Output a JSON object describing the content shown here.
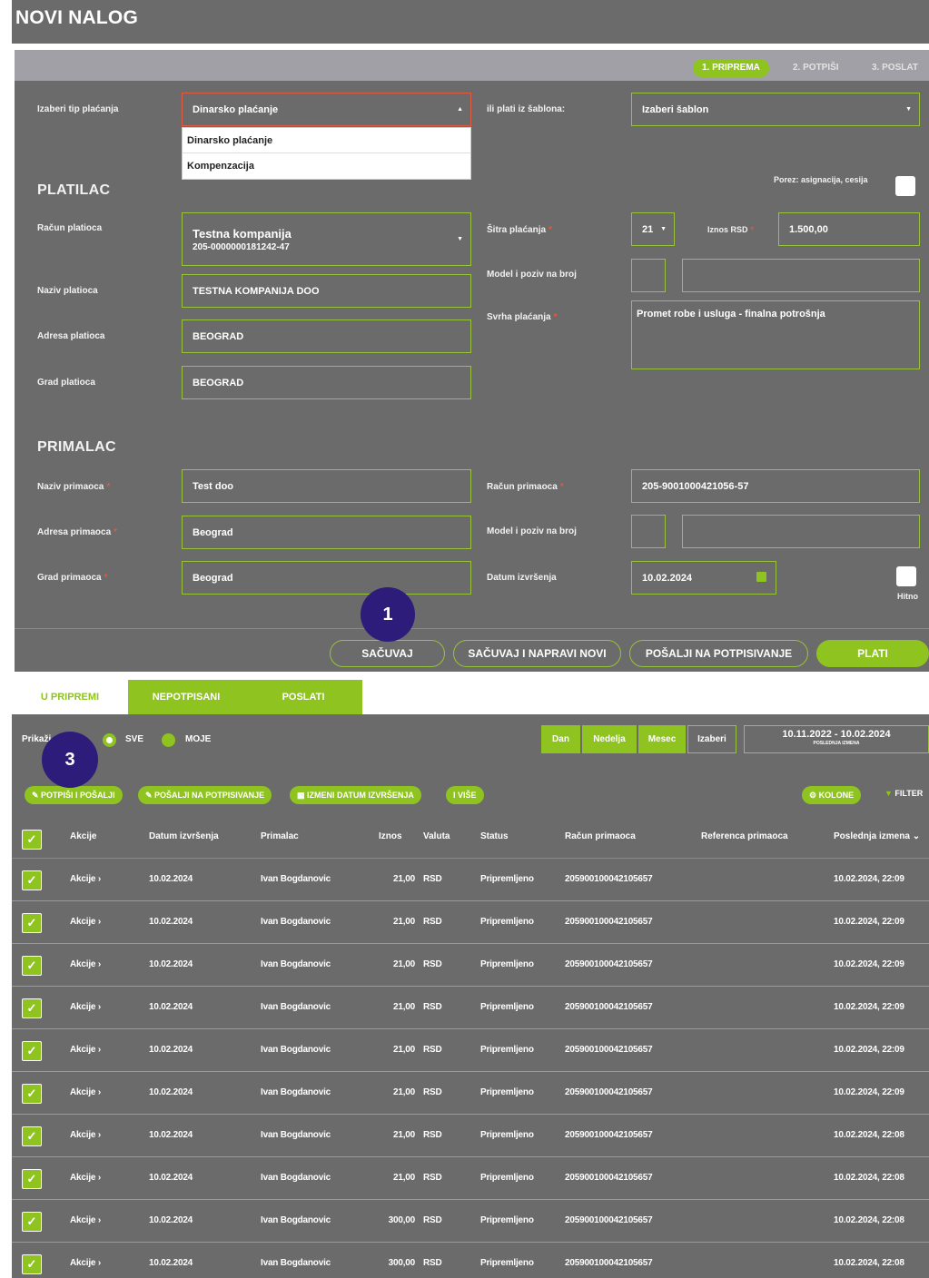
{
  "header": {
    "title": "NOVI NALOG"
  },
  "steps": [
    {
      "label": "1. PRIPREMA",
      "active": true
    },
    {
      "label": "2. POTPIŠI",
      "active": false
    },
    {
      "label": "3. POSLAT",
      "active": false
    }
  ],
  "payment_type": {
    "label": "Izaberi tip plaćanja",
    "value": "Dinarsko plaćanje",
    "options": [
      "Dinarsko plaćanje",
      "Kompenzacija"
    ]
  },
  "template": {
    "label": "ili plati iz šablona:",
    "value": "Izaberi šablon"
  },
  "tax_checkbox_label": "Porez: asignacija, cesija",
  "platilac": {
    "section": "PLATILAC",
    "account_label": "Račun platioca",
    "account_name": "Testna kompanija",
    "account_number": "205-0000000181242-47",
    "name_label": "Naziv platioca",
    "name_value": "TESTNA KOMPANIJA DOO",
    "address_label": "Adresa platioca",
    "address_value": "BEOGRAD",
    "city_label": "Grad platioca",
    "city_value": "BEOGRAD"
  },
  "payment": {
    "code_label": "Šitra plaćanja",
    "code_value": "21",
    "amount_label": "Iznos RSD",
    "amount_value": "1.500,00",
    "model_label": "Model i poziv na broj",
    "purpose_label": "Svrha plaćanja",
    "purpose_value": "Promet robe i usluga - finalna potrošnja"
  },
  "primalac": {
    "section": "PRIMALAC",
    "name_label": "Naziv primaoca",
    "name_value": "Test doo",
    "address_label": "Adresa primaoca",
    "address_value": "Beograd",
    "city_label": "Grad primaoca",
    "city_value": "Beograd",
    "account_label": "Račun primaoca",
    "account_value": "205-9001000421056-57",
    "model_label": "Model i poziv na broj",
    "date_label": "Datum izvršenja",
    "date_value": "10.02.2024",
    "urgent_label": "Hitno"
  },
  "form_actions": {
    "save": "SAČUVAJ",
    "save_new": "SAČUVAJ I NAPRAVI NOVI",
    "send_sign": "POŠALJI NA POTPISIVANJE",
    "pay": "PLATI"
  },
  "markers": {
    "m1": "1",
    "m3": "3"
  },
  "list_tabs": [
    "U PRIPREMI",
    "NEPOTPISANI",
    "POSLATI"
  ],
  "filter": {
    "show_label": "Prikaži",
    "option_all": "SVE",
    "option_mine": "MOJE",
    "periods": [
      "Dan",
      "Nedelja",
      "Mesec",
      "Izaberi"
    ],
    "date_range": "10.11.2022 - 10.02.2024",
    "date_range_sub": "POSLEDNJA IZMENA"
  },
  "bulk_actions": {
    "sign_send": "POTPIŠI I POŠALJI",
    "send_sign": "POŠALJI NA POTPISIVANJE",
    "change_date": "IZMENI DATUM IZVRŠENJA",
    "more": "I VIŠE",
    "columns": "KOLONE",
    "filter": "FILTER"
  },
  "table": {
    "headers": [
      "Akcije",
      "Datum izvršenja",
      "Primalac",
      "Iznos",
      "Valuta",
      "Status",
      "Račun primaoca",
      "Referenca primaoca",
      "Poslednja izmena"
    ],
    "rows": [
      {
        "action": "Akcije",
        "date": "10.02.2024",
        "recipient": "Ivan Bogdanovic",
        "amount": "21,00",
        "currency": "RSD",
        "status": "Pripremljeno",
        "account": "205900100042105657",
        "modified": "10.02.2024, 22:09"
      },
      {
        "action": "Akcije",
        "date": "10.02.2024",
        "recipient": "Ivan Bogdanovic",
        "amount": "21,00",
        "currency": "RSD",
        "status": "Pripremljeno",
        "account": "205900100042105657",
        "modified": "10.02.2024, 22:09"
      },
      {
        "action": "Akcije",
        "date": "10.02.2024",
        "recipient": "Ivan Bogdanovic",
        "amount": "21,00",
        "currency": "RSD",
        "status": "Pripremljeno",
        "account": "205900100042105657",
        "modified": "10.02.2024, 22:09"
      },
      {
        "action": "Akcije",
        "date": "10.02.2024",
        "recipient": "Ivan Bogdanovic",
        "amount": "21,00",
        "currency": "RSD",
        "status": "Pripremljeno",
        "account": "205900100042105657",
        "modified": "10.02.2024, 22:09"
      },
      {
        "action": "Akcije",
        "date": "10.02.2024",
        "recipient": "Ivan Bogdanovic",
        "amount": "21,00",
        "currency": "RSD",
        "status": "Pripremljeno",
        "account": "205900100042105657",
        "modified": "10.02.2024, 22:09"
      },
      {
        "action": "Akcije",
        "date": "10.02.2024",
        "recipient": "Ivan Bogdanovic",
        "amount": "21,00",
        "currency": "RSD",
        "status": "Pripremljeno",
        "account": "205900100042105657",
        "modified": "10.02.2024, 22:09"
      },
      {
        "action": "Akcije",
        "date": "10.02.2024",
        "recipient": "Ivan Bogdanovic",
        "amount": "21,00",
        "currency": "RSD",
        "status": "Pripremljeno",
        "account": "205900100042105657",
        "modified": "10.02.2024, 22:08"
      },
      {
        "action": "Akcije",
        "date": "10.02.2024",
        "recipient": "Ivan Bogdanovic",
        "amount": "21,00",
        "currency": "RSD",
        "status": "Pripremljeno",
        "account": "205900100042105657",
        "modified": "10.02.2024, 22:08"
      },
      {
        "action": "Akcije",
        "date": "10.02.2024",
        "recipient": "Ivan Bogdanovic",
        "amount": "300,00",
        "currency": "RSD",
        "status": "Pripremljeno",
        "account": "205900100042105657",
        "modified": "10.02.2024, 22:08"
      },
      {
        "action": "Akcije",
        "date": "10.02.2024",
        "recipient": "Ivan Bogdanovic",
        "amount": "300,00",
        "currency": "RSD",
        "status": "Pripremljeno",
        "account": "205900100042105657",
        "modified": "10.02.2024, 22:08"
      }
    ]
  },
  "colors": {
    "panel": "#6b6b6b",
    "accent": "#8fc31f",
    "marker": "#2d1c7a",
    "required": "#e05a3f"
  }
}
